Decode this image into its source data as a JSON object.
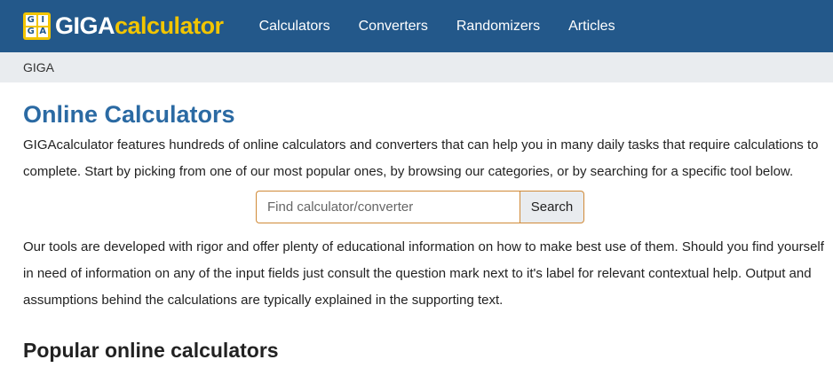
{
  "header": {
    "logo_grid": [
      "G",
      "I",
      "G",
      "A"
    ],
    "logo_part1": "GIGA",
    "logo_part2": "calculator",
    "nav": [
      "Calculators",
      "Converters",
      "Randomizers",
      "Articles"
    ],
    "colors": {
      "bar": "#23588a",
      "accent": "#f2c500"
    }
  },
  "breadcrumb": {
    "root": "GIGA"
  },
  "main": {
    "title": "Online Calculators",
    "intro": "GIGAcalculator features hundreds of online calculators and converters that can help you in many daily tasks that require calculations to complete. Start by picking from one of our most popular ones, by browsing our categories, or by searching for a specific tool below.",
    "search": {
      "placeholder": "Find calculator/converter",
      "button": "Search"
    },
    "body": "Our tools are developed with rigor and offer plenty of educational information on how to make best use of them. Should you find yourself in need of information on any of the input fields just consult the question mark next to it's label for relevant contextual help. Output and assumptions behind the calculations are typically explained in the supporting text.",
    "popular_title": "Popular online calculators"
  }
}
